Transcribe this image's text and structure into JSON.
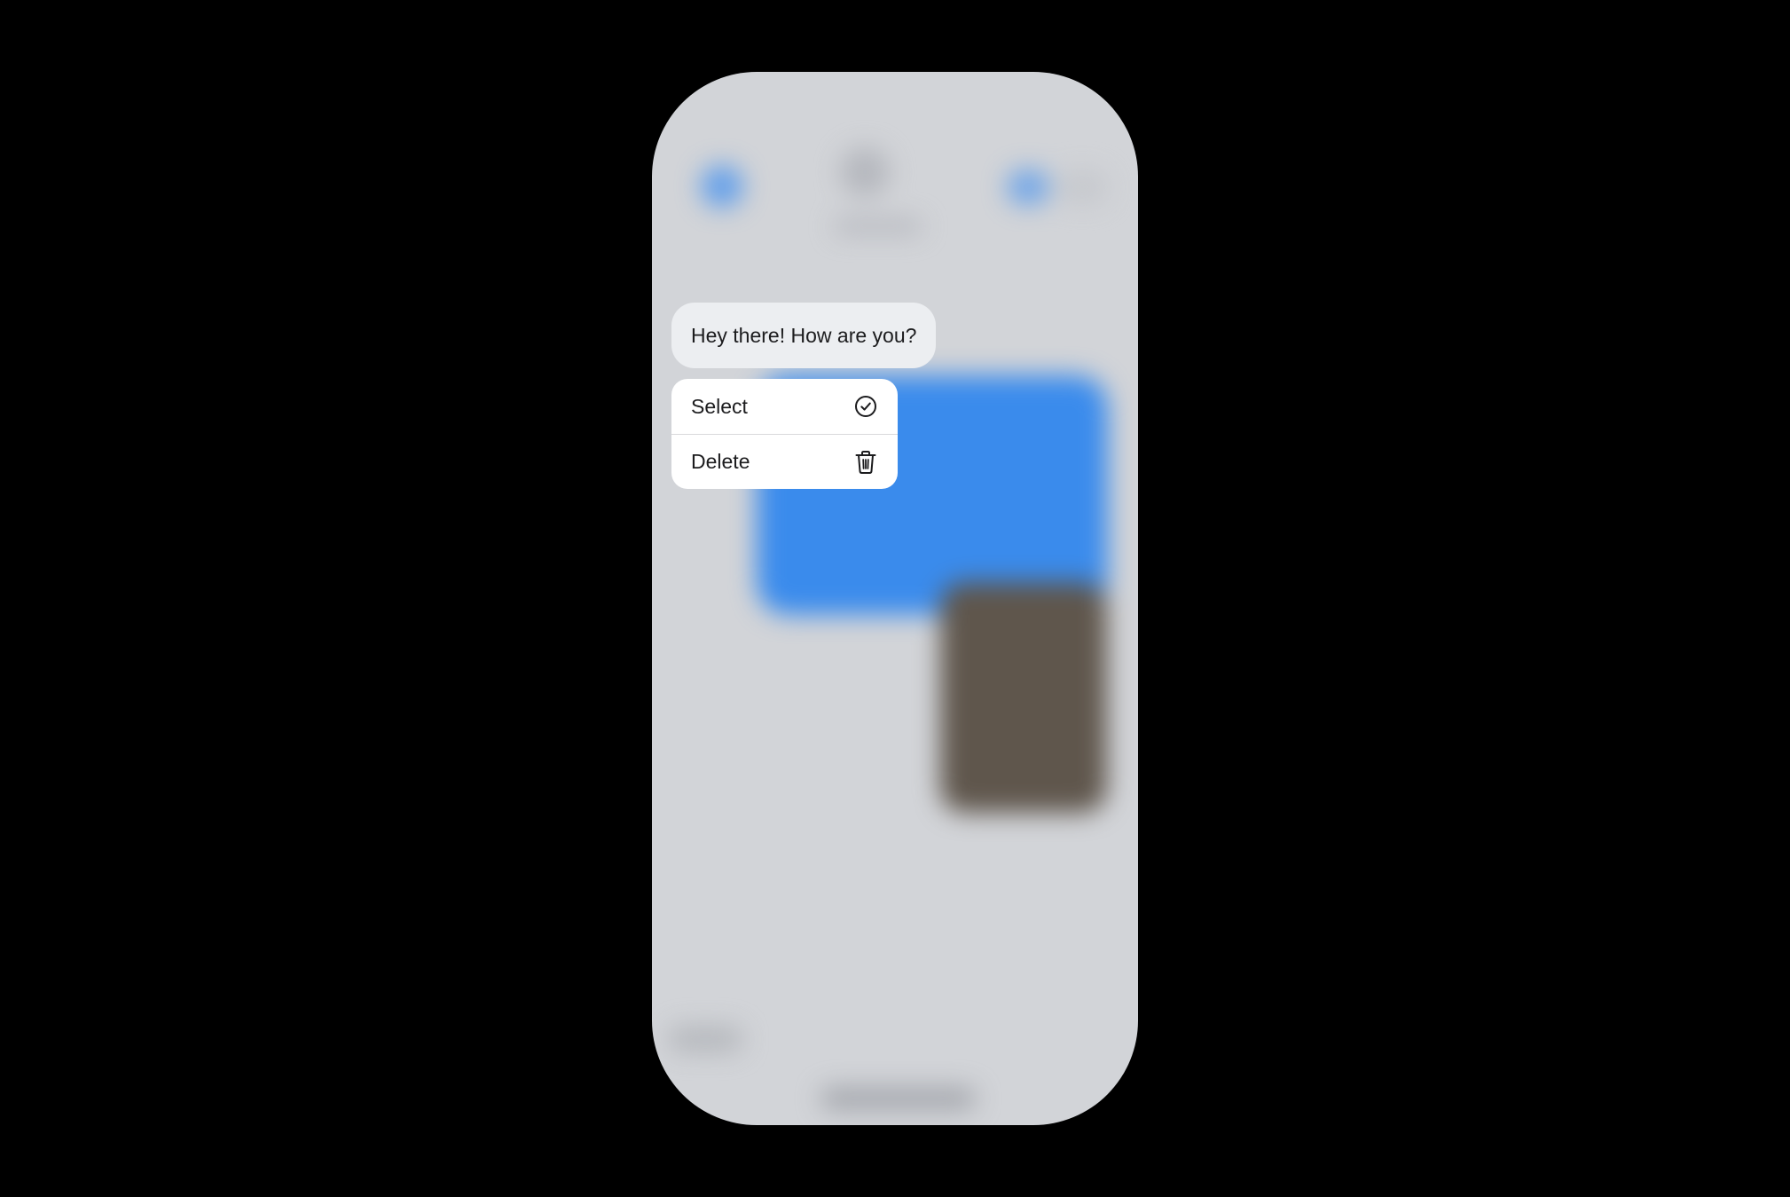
{
  "message": {
    "text": "Hey there! How are you?"
  },
  "context_menu": {
    "items": [
      {
        "label": "Select",
        "icon": "checkmark-circle-icon"
      },
      {
        "label": "Delete",
        "icon": "trash-icon"
      }
    ]
  },
  "colors": {
    "background": "#000000",
    "screen_dim": "#d2d4d8",
    "sent_bubble_blue": "#3a8bec",
    "received_bubble": "#eceef1",
    "menu_background": "#ffffff",
    "text": "#1c1c1e"
  }
}
